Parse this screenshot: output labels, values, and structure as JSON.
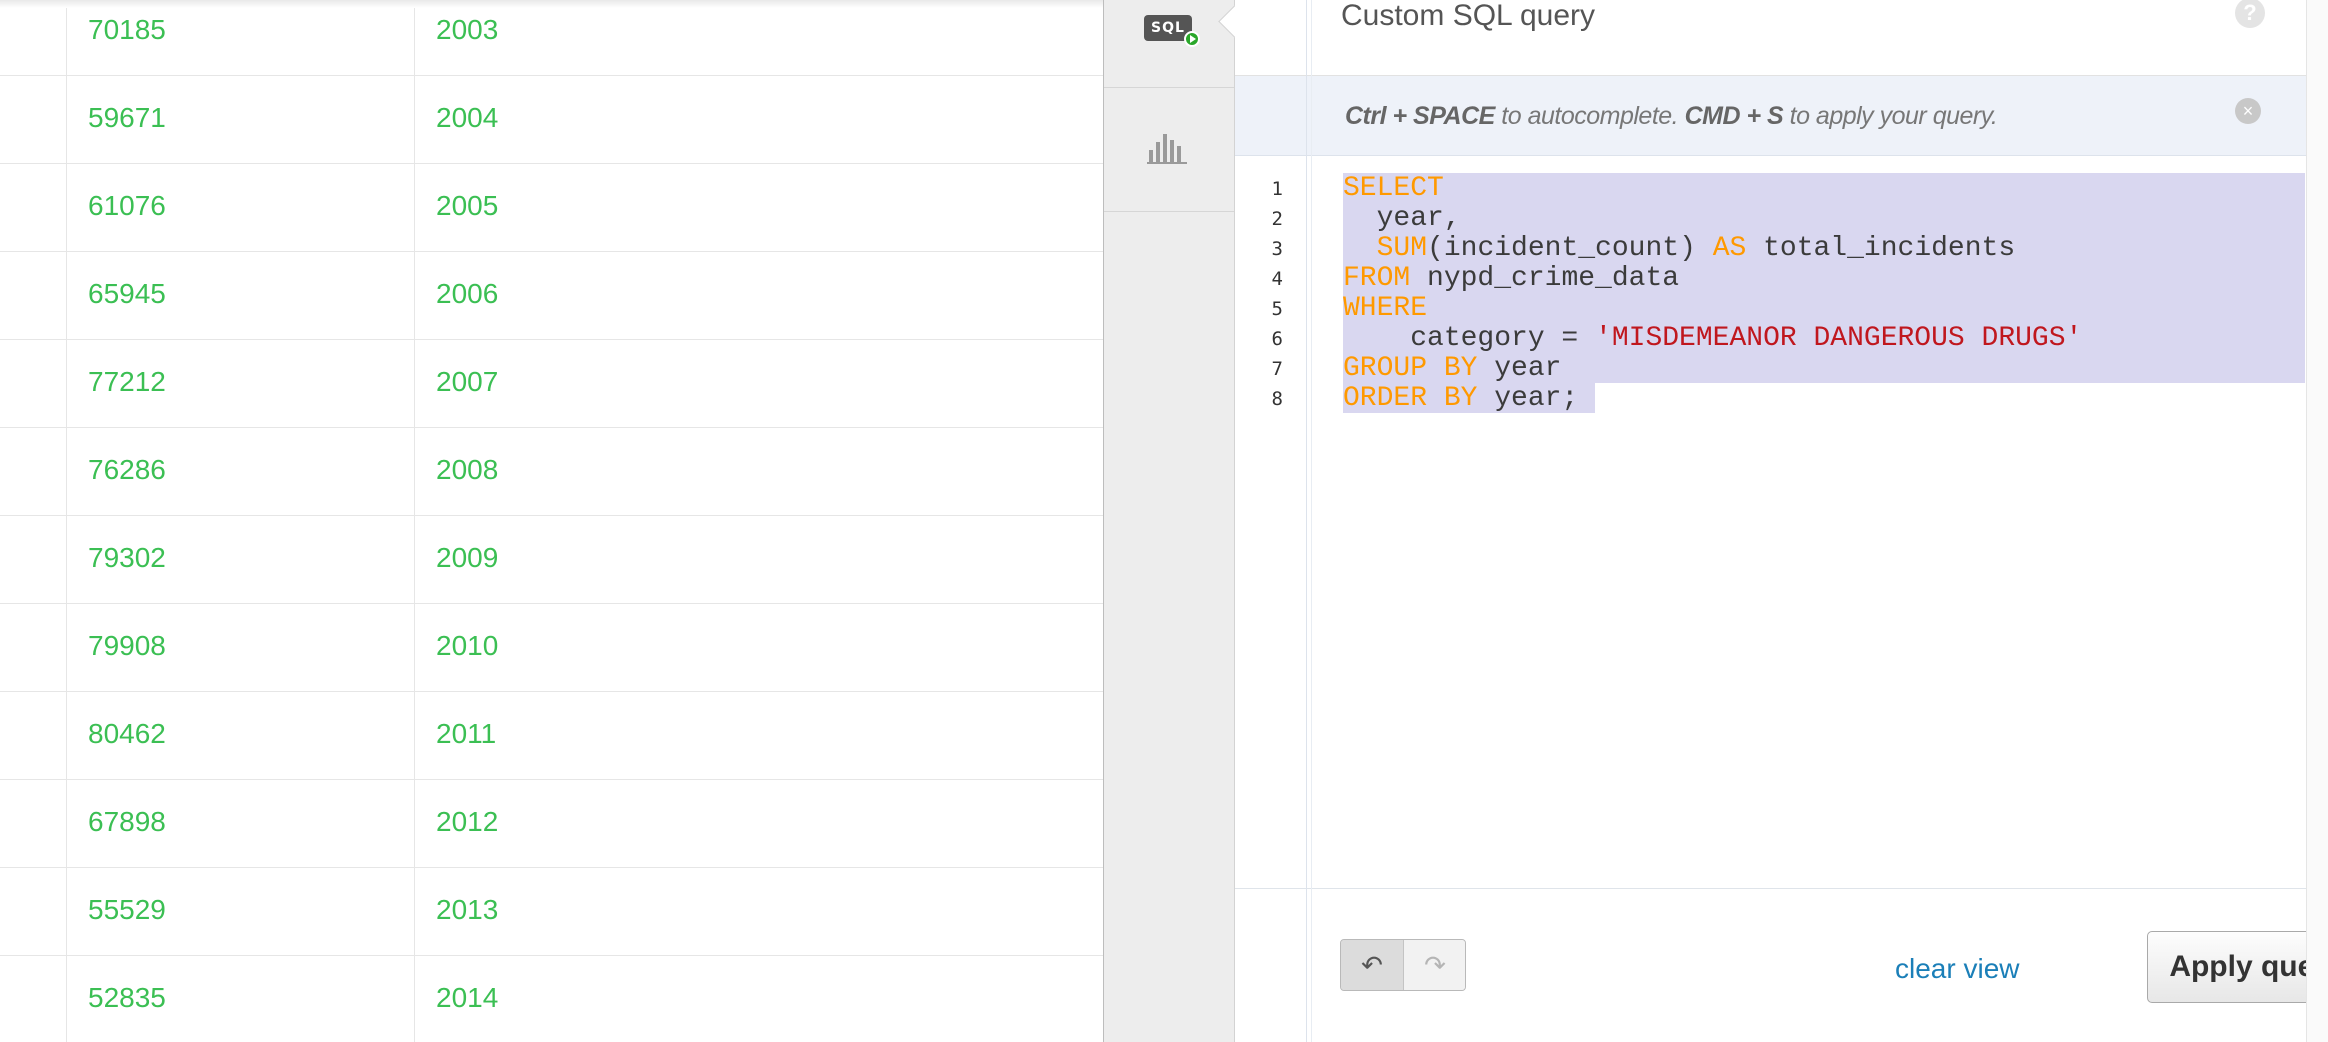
{
  "table": {
    "rows": [
      {
        "incidents": "70185",
        "year": "2003"
      },
      {
        "incidents": "59671",
        "year": "2004"
      },
      {
        "incidents": "61076",
        "year": "2005"
      },
      {
        "incidents": "65945",
        "year": "2006"
      },
      {
        "incidents": "77212",
        "year": "2007"
      },
      {
        "incidents": "76286",
        "year": "2008"
      },
      {
        "incidents": "79302",
        "year": "2009"
      },
      {
        "incidents": "79908",
        "year": "2010"
      },
      {
        "incidents": "80462",
        "year": "2011"
      },
      {
        "incidents": "67898",
        "year": "2012"
      },
      {
        "incidents": "55529",
        "year": "2013"
      },
      {
        "incidents": "52835",
        "year": "2014"
      }
    ],
    "value_color": "#3bbf53"
  },
  "sidebar": {
    "sql_tab_icon": "sql-run-icon",
    "sql_icon_text": "SQL",
    "chart_tab_icon": "bar-chart-icon"
  },
  "panel": {
    "title": "Custom SQL query",
    "help_icon": "question-icon",
    "help_glyph": "?",
    "hint": {
      "key1": "Ctrl + SPACE",
      "text1": " to autocomplete. ",
      "key2": "CMD + S",
      "text2": " to apply your query."
    },
    "hint_close_icon": "close-circle-icon",
    "hint_close_glyph": "×"
  },
  "editor": {
    "line_numbers": [
      "1",
      "2",
      "3",
      "4",
      "5",
      "6",
      "7",
      "8"
    ],
    "lines": [
      [
        {
          "t": "SELECT",
          "k": "kw"
        }
      ],
      [
        {
          "t": "  year,",
          "k": "id"
        }
      ],
      [
        {
          "t": "  ",
          "k": "id"
        },
        {
          "t": "SUM",
          "k": "kw"
        },
        {
          "t": "(incident_count) ",
          "k": "id"
        },
        {
          "t": "AS",
          "k": "kw"
        },
        {
          "t": " total_incidents",
          "k": "id"
        }
      ],
      [
        {
          "t": "FROM",
          "k": "kw"
        },
        {
          "t": " nypd_crime_data",
          "k": "id"
        }
      ],
      [
        {
          "t": "WHERE",
          "k": "kw"
        }
      ],
      [
        {
          "t": "    category = ",
          "k": "id"
        },
        {
          "t": "'MISDEMEANOR DANGEROUS DRUGS'",
          "k": "str"
        }
      ],
      [
        {
          "t": "GROUP BY",
          "k": "kw"
        },
        {
          "t": " year",
          "k": "id"
        }
      ],
      [
        {
          "t": "ORDER BY",
          "k": "kw"
        },
        {
          "t": " year;",
          "k": "id"
        }
      ]
    ],
    "keyword_color": "#ff9900",
    "string_color": "#c0171e",
    "selection_color": "#d9d7f0"
  },
  "footer": {
    "undo_icon": "undo-icon",
    "undo_glyph": "↶",
    "redo_icon": "redo-icon",
    "redo_glyph": "↷",
    "clear_view_label": "clear view",
    "apply_label": "Apply query"
  }
}
